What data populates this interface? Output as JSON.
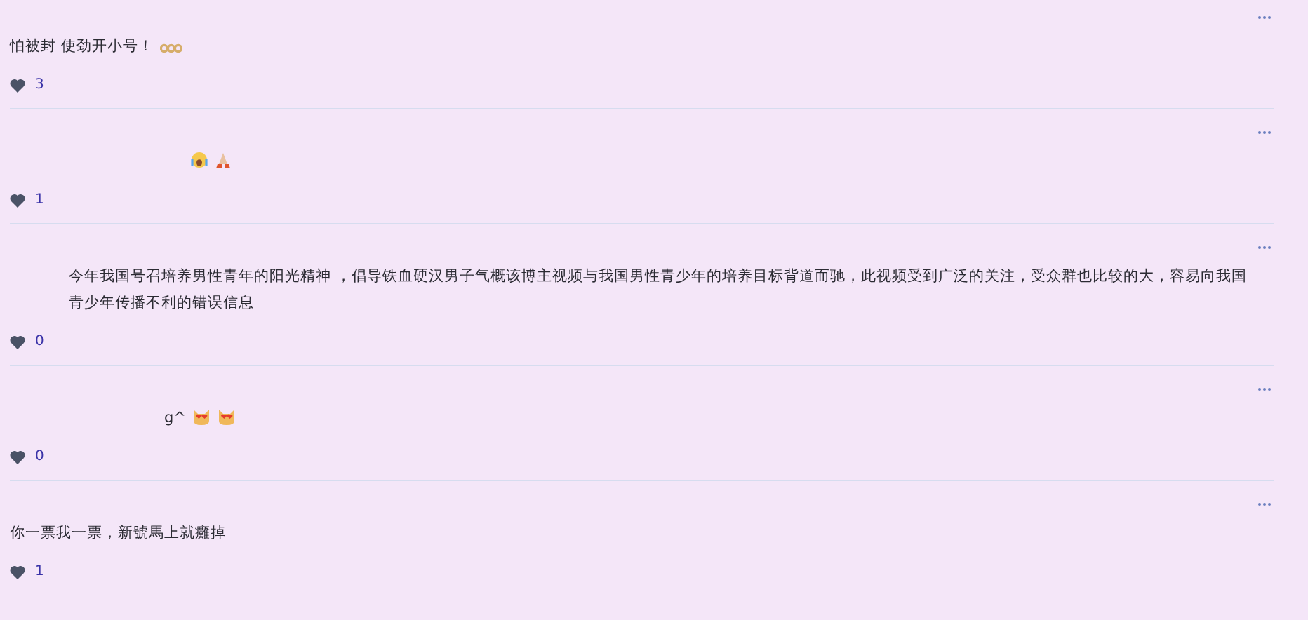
{
  "comments": [
    {
      "text": "怕被封 使劲开小号！",
      "emojis": [
        {
          "kind": "sixsixsix"
        }
      ],
      "indent": false,
      "likes": "3"
    },
    {
      "emojis": [
        {
          "kind": "crying"
        },
        {
          "kind": "pray"
        }
      ],
      "indent": true,
      "likes": "1"
    },
    {
      "text": "今年我国号召培养男性青年的阳光精神 ，倡导铁血硬汉男子气概该博主视频与我国男性青少年的培养目标背道而驰，此视频受到广泛的关注，受众群也比较的大，容易向我国青少年传播不利的错误信息",
      "indent": true,
      "likes": "0"
    },
    {
      "text": "g^",
      "emojis": [
        {
          "kind": "heartcat"
        },
        {
          "kind": "heartcat"
        }
      ],
      "indent": true,
      "likes": "0"
    },
    {
      "text": "你一票我一票，新號馬上就癱掉",
      "indent": false,
      "likes": "1"
    }
  ]
}
